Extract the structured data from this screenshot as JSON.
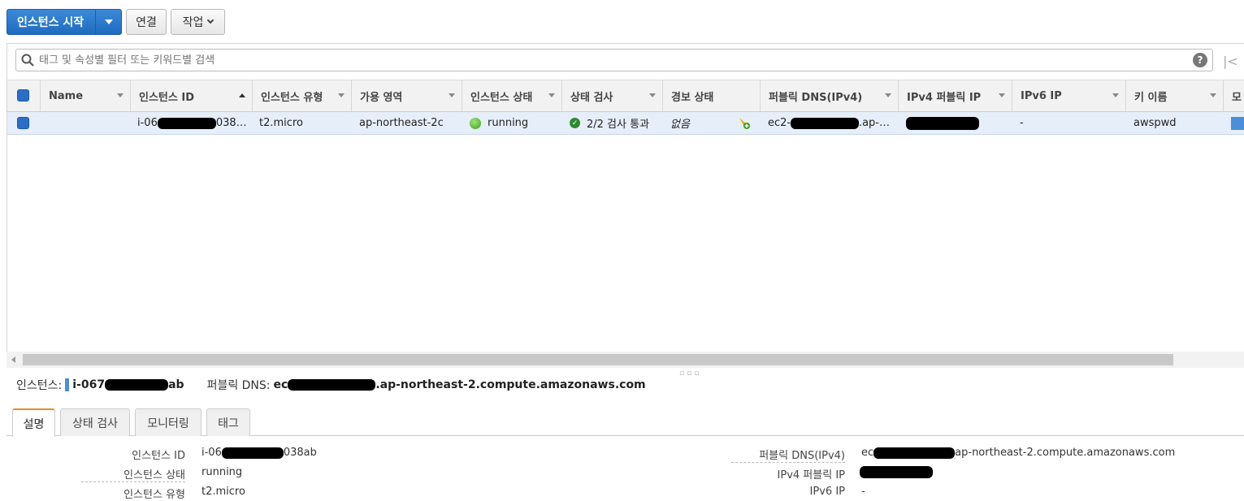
{
  "toolbar": {
    "launch_label": "인스턴스 시작",
    "connect_label": "연결",
    "actions_label": "작업"
  },
  "search": {
    "placeholder": "태그 및 속성별 필터 또는 키워드별 검색"
  },
  "columns": [
    "Name",
    "인스턴스 ID",
    "인스턴스 유형",
    "가용 영역",
    "인스턴스 상태",
    "상태 검사",
    "경보 상태",
    "퍼블릭 DNS(IPv4)",
    "IPv4 퍼블릭 IP",
    "IPv6 IP",
    "키 이름",
    "모"
  ],
  "row": {
    "name": "",
    "instance_id_prefix": "i-06",
    "instance_id_suffix": "038…",
    "instance_type": "t2.micro",
    "availability_zone": "ap-northeast-2c",
    "instance_state": "running",
    "status_check": "2/2 검사 통과",
    "alarm_status": "없음",
    "public_dns_prefix": "ec2-",
    "public_dns_suffix": ".ap-…",
    "ipv6_ip": "-",
    "key_name": "awspwd"
  },
  "summary": {
    "instance_label": "인스턴스:",
    "instance_prefix": "i-067",
    "instance_suffix": "ab",
    "dns_label": "퍼블릭 DNS:",
    "dns_prefix": "ec",
    "dns_suffix": ".ap-northeast-2.compute.amazonaws.com"
  },
  "tabs": [
    "설명",
    "상태 검사",
    "모니터링",
    "태그"
  ],
  "details_left": {
    "instance_id_label": "인스턴스 ID",
    "instance_id_prefix": "i-06",
    "instance_id_suffix": "038ab",
    "instance_state_label": "인스턴스 상태",
    "instance_state_value": "running",
    "instance_type_label": "인스턴스 유형",
    "instance_type_value": "t2.micro"
  },
  "details_right": {
    "public_dns_label": "퍼블릭 DNS(IPv4)",
    "public_dns_prefix": "ec",
    "public_dns_suffix": "ap-northeast-2.compute.amazonaws.com",
    "ipv4_label": "IPv4 퍼블릭 IP",
    "ipv6_label": "IPv6 IP",
    "ipv6_value": "-"
  },
  "colors": {
    "primary": "#1f6bc0",
    "selected_row": "#e6eef9",
    "tab_accent": "#e88d2b"
  }
}
